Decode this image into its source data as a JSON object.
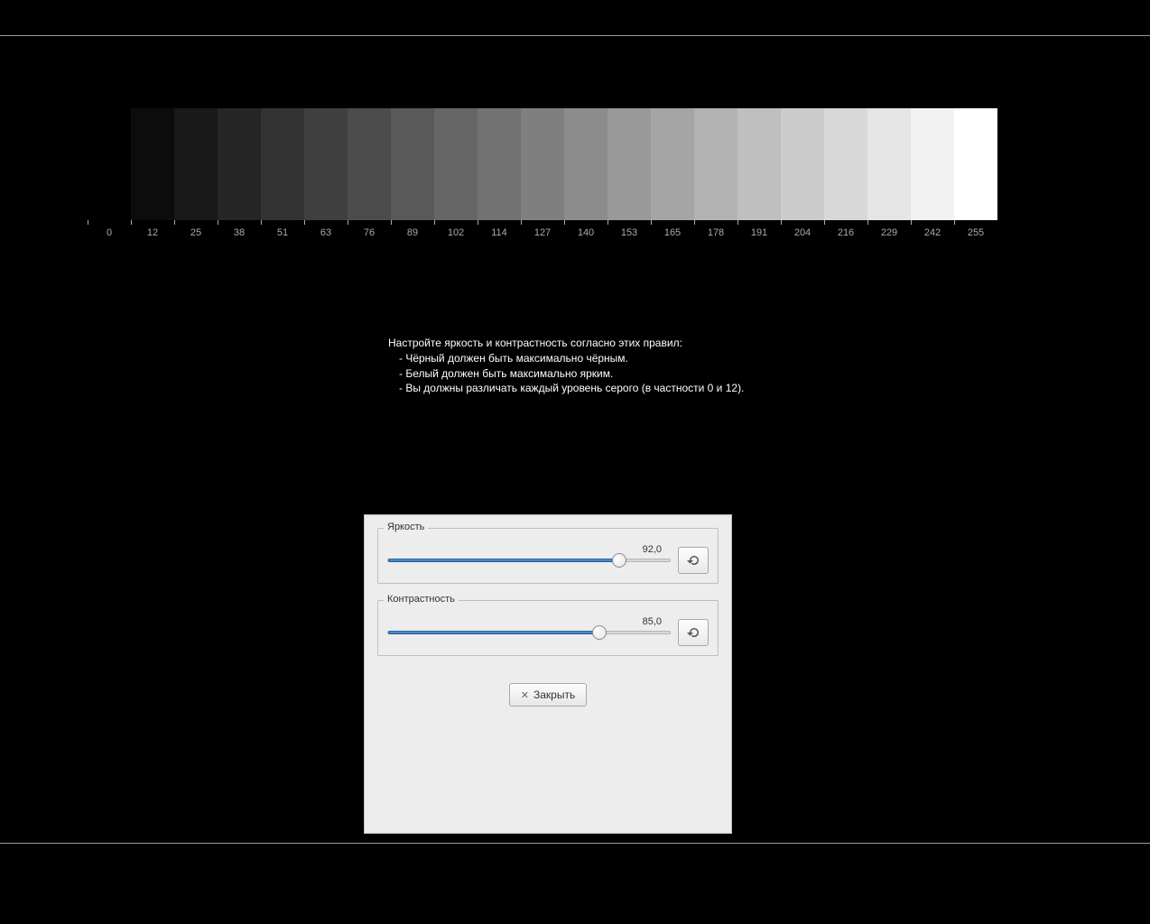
{
  "gradient": {
    "steps": [
      0,
      12,
      25,
      38,
      51,
      63,
      76,
      89,
      102,
      114,
      127,
      140,
      153,
      165,
      178,
      191,
      204,
      216,
      229,
      242,
      255
    ]
  },
  "instructions": {
    "heading": "Настройте яркость и контрастность согласно этих правил:",
    "rules": [
      "- Чёрный должен быть максимально чёрным.",
      "- Белый должен быть максимально ярким.",
      "- Вы должны различать каждый уровень серого (в частности 0 и 12)."
    ]
  },
  "dialog": {
    "brightness": {
      "label": "Яркость",
      "value": "92,0",
      "percent": 82
    },
    "contrast": {
      "label": "Контрастность",
      "value": "85,0",
      "percent": 75
    },
    "close_label": "Закрыть"
  }
}
